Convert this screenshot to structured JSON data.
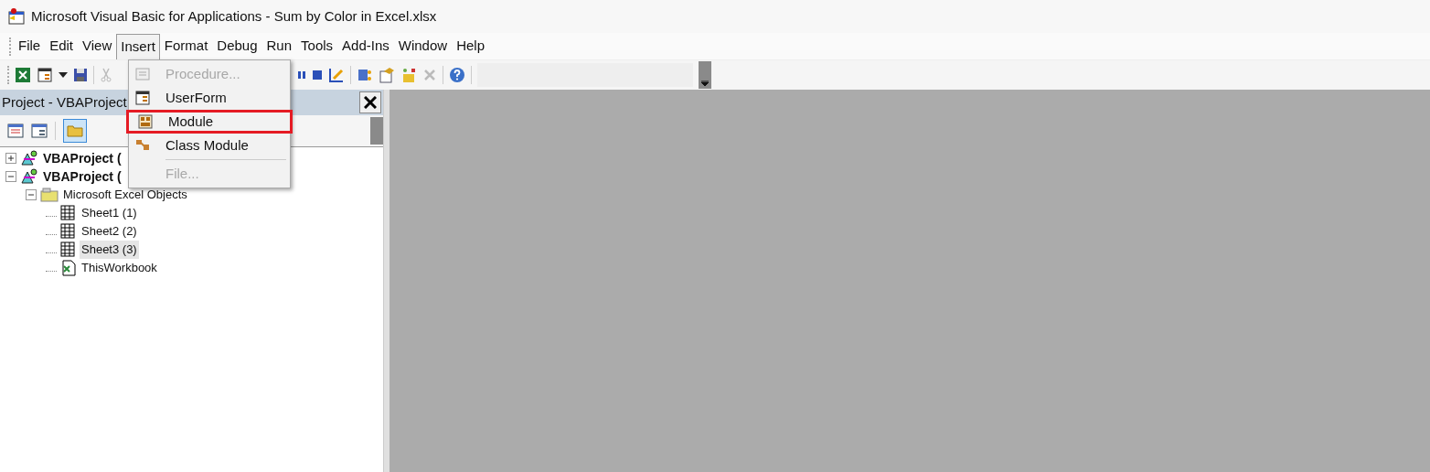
{
  "window": {
    "title": "Microsoft Visual Basic for Applications - Sum by Color in Excel.xlsx"
  },
  "menu_bar": [
    {
      "label": "File",
      "selected": false
    },
    {
      "label": "Edit",
      "selected": false
    },
    {
      "label": "View",
      "selected": false
    },
    {
      "label": "Insert",
      "selected": true
    },
    {
      "label": "Format",
      "selected": false
    },
    {
      "label": "Debug",
      "selected": false
    },
    {
      "label": "Run",
      "selected": false
    },
    {
      "label": "Tools",
      "selected": false
    },
    {
      "label": "Add-Ins",
      "selected": false
    },
    {
      "label": "Window",
      "selected": false
    },
    {
      "label": "Help",
      "selected": false
    }
  ],
  "insert_menu": [
    {
      "label": "Procedure...",
      "disabled": true,
      "highlighted": false
    },
    {
      "label": "UserForm",
      "disabled": false,
      "highlighted": false
    },
    {
      "label": "Module",
      "disabled": false,
      "highlighted": true
    },
    {
      "label": "Class Module",
      "disabled": false,
      "highlighted": false
    },
    {
      "label": "File...",
      "disabled": true,
      "highlighted": false
    }
  ],
  "project_panel": {
    "title": "Project - VBAProject",
    "tree": [
      {
        "label": "VBAProject (",
        "kind": "project",
        "expanded": false,
        "selected": false
      },
      {
        "label": "VBAProject (",
        "kind": "project",
        "expanded": true,
        "selected": false,
        "children": [
          {
            "label": "Microsoft Excel Objects",
            "kind": "folder",
            "expanded": true,
            "selected": false,
            "children": [
              {
                "label": "Sheet1 (1)",
                "kind": "sheet",
                "selected": false
              },
              {
                "label": "Sheet2 (2)",
                "kind": "sheet",
                "selected": false
              },
              {
                "label": "Sheet3 (3)",
                "kind": "sheet",
                "selected": true
              },
              {
                "label": "ThisWorkbook",
                "kind": "workbook",
                "selected": false
              }
            ]
          }
        ]
      }
    ]
  }
}
